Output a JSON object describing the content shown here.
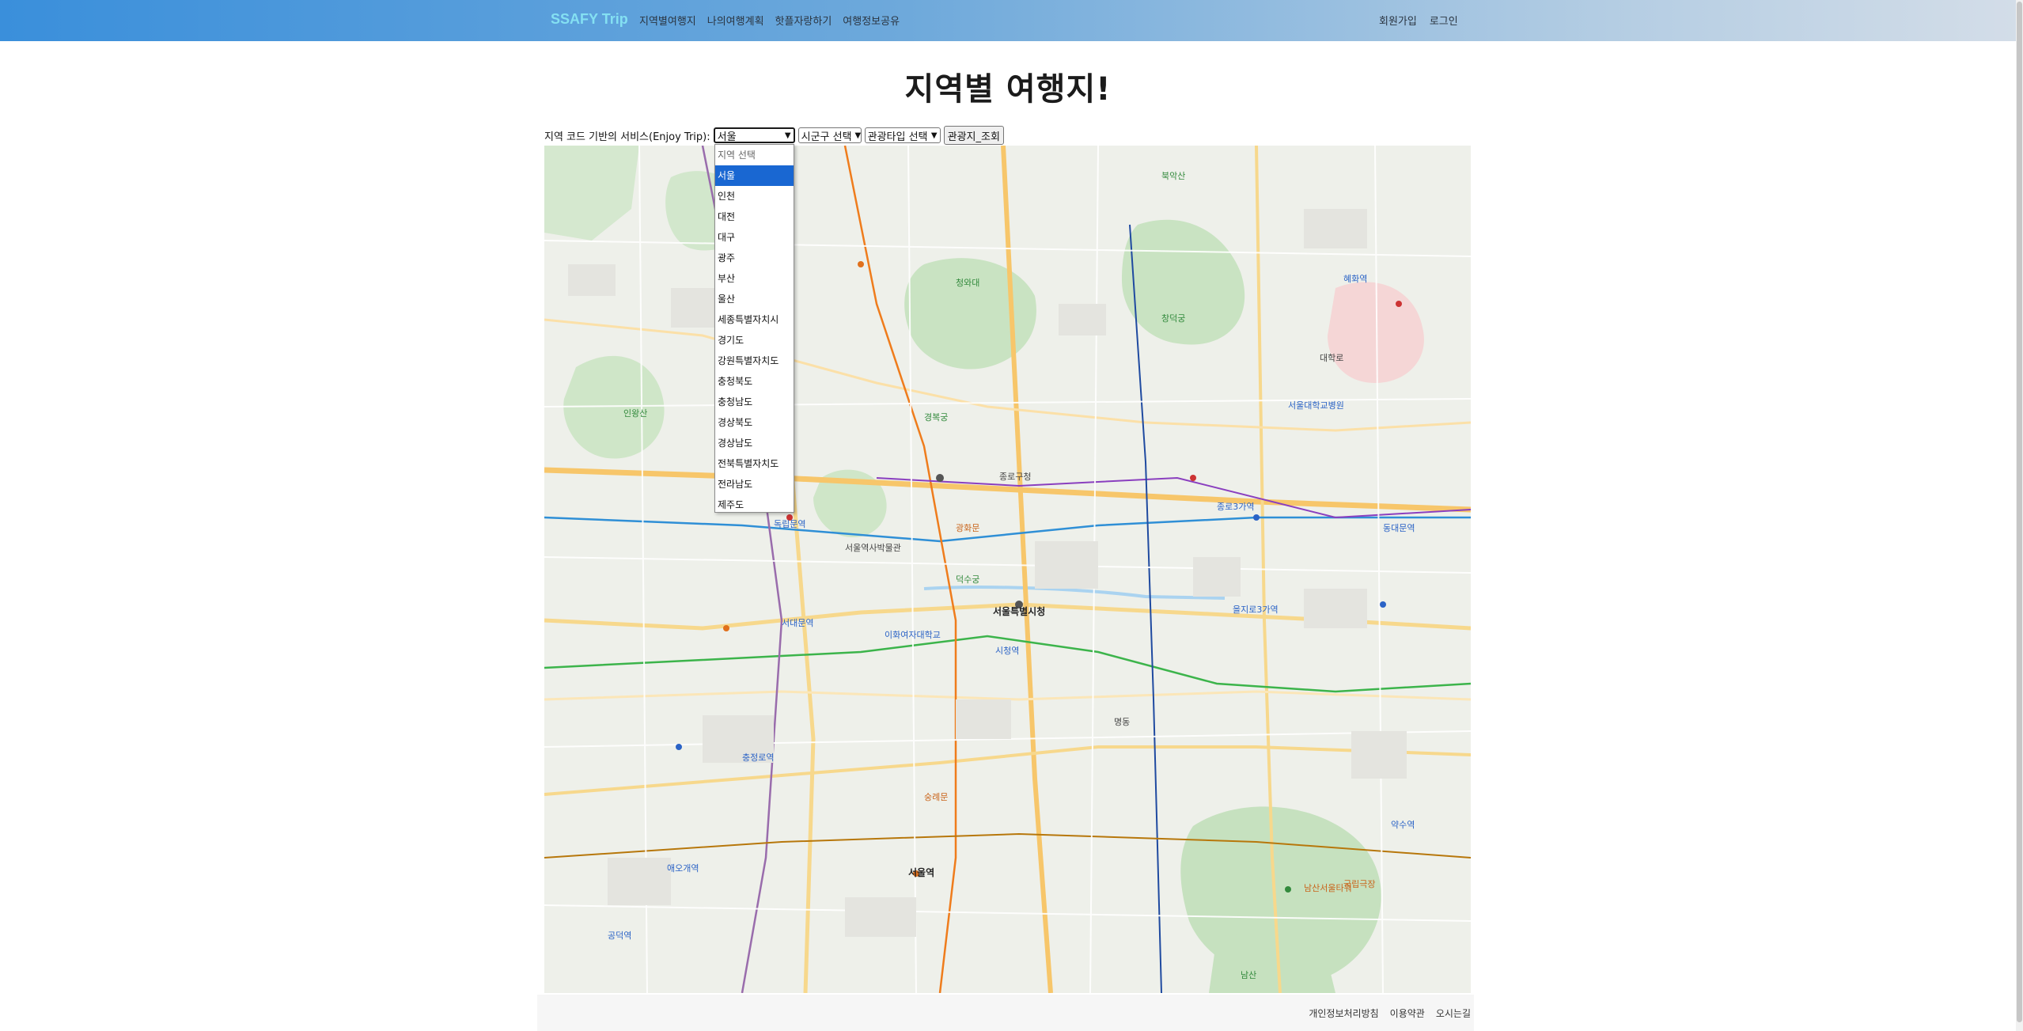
{
  "navbar": {
    "brand": "SSAFY Trip",
    "left_links": [
      "지역별여행지",
      "나의여행계획",
      "핫플자랑하기",
      "여행정보공유"
    ],
    "right_links": [
      "회원가입",
      "로그인"
    ]
  },
  "page": {
    "title": "지역별 여행지!"
  },
  "search": {
    "label": "지역 코드 기반의 서비스(Enjoy Trip):",
    "sido_value": "서울",
    "gugun_value": "시군구 선택",
    "type_value": "관광타입 선택",
    "button_label": "관광지_조회"
  },
  "dropdown": {
    "options": [
      "지역 선택",
      "서울",
      "인천",
      "대전",
      "대구",
      "광주",
      "부산",
      "울산",
      "세종특별자치시",
      "경기도",
      "강원특별자치도",
      "충청북도",
      "충청남도",
      "경상북도",
      "경상남도",
      "전북특별자치도",
      "전라남도",
      "제주도"
    ],
    "selected": "서울"
  },
  "map": {
    "labels": [
      "서울특별시청",
      "청와대",
      "종로구청",
      "경복궁",
      "창덕궁",
      "서울역",
      "남산",
      "서대문역",
      "충정로역",
      "시청역",
      "광화문",
      "종로3가역",
      "동대문역",
      "을지로3가역",
      "서울대학교병원",
      "숭례문",
      "명동",
      "이화여자대학교",
      "독립문역",
      "애오개역",
      "공덕역",
      "대학로",
      "혜화역",
      "남산서울타워",
      "국립극장",
      "약수역",
      "서울역사박물관",
      "덕수궁",
      "인왕산",
      "북악산"
    ]
  },
  "footer": {
    "links": [
      "개인정보처리방침",
      "이용약관",
      "오시는길"
    ]
  }
}
